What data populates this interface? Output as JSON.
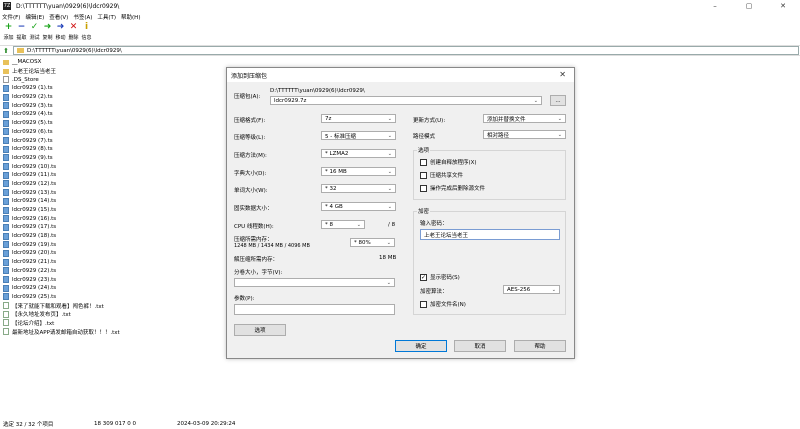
{
  "window": {
    "icon": "7Z",
    "title": "D:\\TTTTTT\\yuan\\0929(6)\\ldcr0929\\",
    "minimize_icon": "–",
    "maximize_icon": "▢",
    "close_icon": "✕"
  },
  "menu": {
    "items": [
      "文件(F)",
      "编辑(E)",
      "查看(V)",
      "书签(A)",
      "工具(T)",
      "帮助(H)"
    ]
  },
  "toolbar": {
    "buttons": [
      {
        "label": "添加",
        "icon": "+",
        "color": "#1aa31a"
      },
      {
        "label": "提取",
        "icon": "−",
        "color": "#1f3fb8"
      },
      {
        "label": "测试",
        "icon": "✓",
        "color": "#1aa31a"
      },
      {
        "label": "复制",
        "icon": "➜",
        "color": "#1aa31a"
      },
      {
        "label": "移动",
        "icon": "➜",
        "color": "#1f3fb8"
      },
      {
        "label": "删除",
        "icon": "✕",
        "color": "#d01010"
      },
      {
        "label": "信息",
        "icon": "i",
        "color": "#c8a000"
      }
    ]
  },
  "address": {
    "path": "D:\\TTTTTT\\yuan\\0929(6)\\ldcr0929\\"
  },
  "files": [
    {
      "name": "__MACOSX",
      "type": "folder"
    },
    {
      "name": "上老王论坛当老王",
      "type": "folder"
    },
    {
      "name": ".DS_Store",
      "type": "doc"
    },
    {
      "name": "ldcr0929 (1).ts",
      "type": "media"
    },
    {
      "name": "ldcr0929 (2).ts",
      "type": "media"
    },
    {
      "name": "ldcr0929 (3).ts",
      "type": "media"
    },
    {
      "name": "ldcr0929 (4).ts",
      "type": "media"
    },
    {
      "name": "ldcr0929 (5).ts",
      "type": "media"
    },
    {
      "name": "ldcr0929 (6).ts",
      "type": "media"
    },
    {
      "name": "ldcr0929 (7).ts",
      "type": "media"
    },
    {
      "name": "ldcr0929 (8).ts",
      "type": "media"
    },
    {
      "name": "ldcr0929 (9).ts",
      "type": "media"
    },
    {
      "name": "ldcr0929 (10).ts",
      "type": "media"
    },
    {
      "name": "ldcr0929 (11).ts",
      "type": "media"
    },
    {
      "name": "ldcr0929 (12).ts",
      "type": "media"
    },
    {
      "name": "ldcr0929 (13).ts",
      "type": "media"
    },
    {
      "name": "ldcr0929 (14).ts",
      "type": "media"
    },
    {
      "name": "ldcr0929 (15).ts",
      "type": "media"
    },
    {
      "name": "ldcr0929 (16).ts",
      "type": "media"
    },
    {
      "name": "ldcr0929 (17).ts",
      "type": "media"
    },
    {
      "name": "ldcr0929 (18).ts",
      "type": "media"
    },
    {
      "name": "ldcr0929 (19).ts",
      "type": "media"
    },
    {
      "name": "ldcr0929 (20).ts",
      "type": "media"
    },
    {
      "name": "ldcr0929 (21).ts",
      "type": "media"
    },
    {
      "name": "ldcr0929 (22).ts",
      "type": "media"
    },
    {
      "name": "ldcr0929 (23).ts",
      "type": "media"
    },
    {
      "name": "ldcr0929 (24).ts",
      "type": "media"
    },
    {
      "name": "ldcr0929 (25).ts",
      "type": "media"
    },
    {
      "name": "【来了就能下载和观看】闯色裤！.txt",
      "type": "text"
    },
    {
      "name": "【永久地址发布页】.txt",
      "type": "text"
    },
    {
      "name": "【论坛介绍】.txt",
      "type": "text"
    },
    {
      "name": "最新地址及APP请发邮箱自动获取！！！.txt",
      "type": "text"
    }
  ],
  "status": {
    "selected": "选定 32 / 32 个项目",
    "size": "18 309 017 0 0",
    "date": "2024-03-09 20:29:24"
  },
  "dialog": {
    "title": "添加到压缩包",
    "close_icon": "✕",
    "archive_label": "压缩包(A):",
    "archive_dir": "D:\\TTTTTT\\yuan\\0929(6)\\ldcr0929\\",
    "archive_name": "ldcr0929.7z",
    "browse_label": "...",
    "format_label": "压缩格式(F):",
    "format_value": "7z",
    "level_label": "压缩等级(L):",
    "level_value": "5 - 标准压缩",
    "method_label": "压缩方法(M):",
    "method_value": "* LZMA2",
    "dict_label": "字典大小(D):",
    "dict_value": "* 16 MB",
    "word_label": "单词大小(W):",
    "word_value": "* 32",
    "solid_label": "固实数据大小：",
    "solid_value": "* 4 GB",
    "threads_label": "CPU 线程数(H):",
    "threads_value": "* 8",
    "threads_total": "/ 8",
    "mem_label": "压缩所需内存：",
    "mem_detail": "1248 MB / 1434 MB / 4096 MB",
    "mem_value": "* 80%",
    "decomp_label": "解压缩所需内存：",
    "decomp_value": "18 MB",
    "split_label": "分卷大小，字节(V):",
    "split_value": "",
    "params_label": "参数(P):",
    "params_value": "",
    "options_button": "选项",
    "update_label": "更新方式(U):",
    "update_value": "添加并替换文件",
    "pathmode_label": "路径模式",
    "pathmode_value": "相对路径",
    "options_group": "选项",
    "opt_sfx": "创建自释放程序(X)",
    "opt_shared": "压缩共享文件",
    "opt_delete": "操作完成后删除源文件",
    "encrypt_group": "加密",
    "password_label": "输入密码：",
    "password_value": "上老王论坛当老王",
    "show_password": "显示密码(S)",
    "show_password_checked": "✓",
    "enc_method_label": "加密算法：",
    "enc_method_value": "AES-256",
    "encrypt_names": "加密文件名(N)",
    "ok_button": "确定",
    "cancel_button": "取消",
    "help_button": "帮助",
    "dropdown_icon": "⌄"
  }
}
